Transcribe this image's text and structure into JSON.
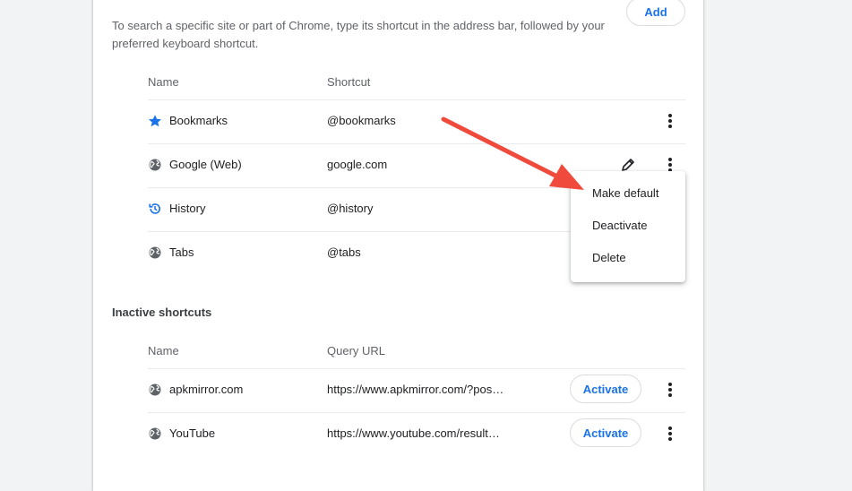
{
  "header": {
    "description": "To search a specific site or part of Chrome, type its shortcut in the address bar, followed by your preferred keyboard shortcut.",
    "add_label": "Add"
  },
  "active": {
    "col_name": "Name",
    "col_shortcut": "Shortcut",
    "rows": [
      {
        "name": "Bookmarks",
        "shortcut": "@bookmarks",
        "icon": "star-icon"
      },
      {
        "name": "Google (Web)",
        "shortcut": "google.com",
        "icon": "globe-icon"
      },
      {
        "name": "History",
        "shortcut": "@history",
        "icon": "history-icon"
      },
      {
        "name": "Tabs",
        "shortcut": "@tabs",
        "icon": "globe-icon"
      }
    ]
  },
  "inactive": {
    "title": "Inactive shortcuts",
    "col_name": "Name",
    "col_url": "Query URL",
    "activate_label": "Activate",
    "rows": [
      {
        "name": "apkmirror.com",
        "url": "https://www.apkmirror.com/?pos…",
        "icon": "globe-icon"
      },
      {
        "name": "YouTube",
        "url": "https://www.youtube.com/result…",
        "icon": "globe-icon"
      }
    ]
  },
  "menu": {
    "items": [
      "Make default",
      "Deactivate",
      "Delete"
    ]
  },
  "colors": {
    "accent": "#1a73e8",
    "annotation_arrow": "#ef4a3c"
  }
}
